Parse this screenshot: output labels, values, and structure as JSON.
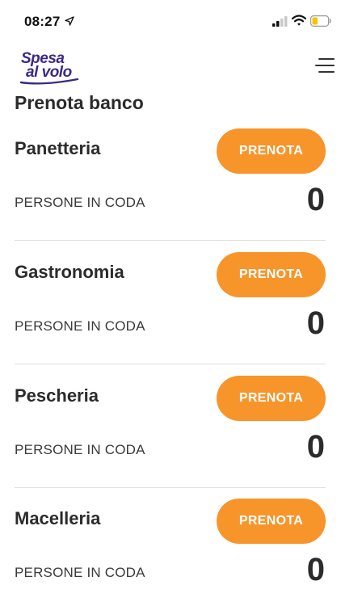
{
  "status_bar": {
    "time": "08:27",
    "icons": [
      "location-arrow-icon",
      "cellular-signal-icon",
      "wifi-icon",
      "battery-low-icon"
    ]
  },
  "header": {
    "logo_line1": "Spesa",
    "logo_line2": "al volo",
    "menu_icon": "hamburger-menu-icon"
  },
  "page": {
    "title": "Prenota banco"
  },
  "counters": [
    {
      "name": "Panetteria",
      "button_label": "PRENOTA",
      "queue_label": "PERSONE IN CODA",
      "queue_count": "0"
    },
    {
      "name": "Gastronomia",
      "button_label": "PRENOTA",
      "queue_label": "PERSONE IN CODA",
      "queue_count": "0"
    },
    {
      "name": "Pescheria",
      "button_label": "PRENOTA",
      "queue_label": "PERSONE IN CODA",
      "queue_count": "0"
    },
    {
      "name": "Macelleria",
      "button_label": "PRENOTA",
      "queue_label": "PERSONE IN CODA",
      "queue_count": "0"
    }
  ],
  "colors": {
    "accent": "#f7952b",
    "brand": "#3b2a86",
    "text": "#2b2b2b",
    "divider": "#e4e1da",
    "battery_fill": "#f5c400"
  }
}
